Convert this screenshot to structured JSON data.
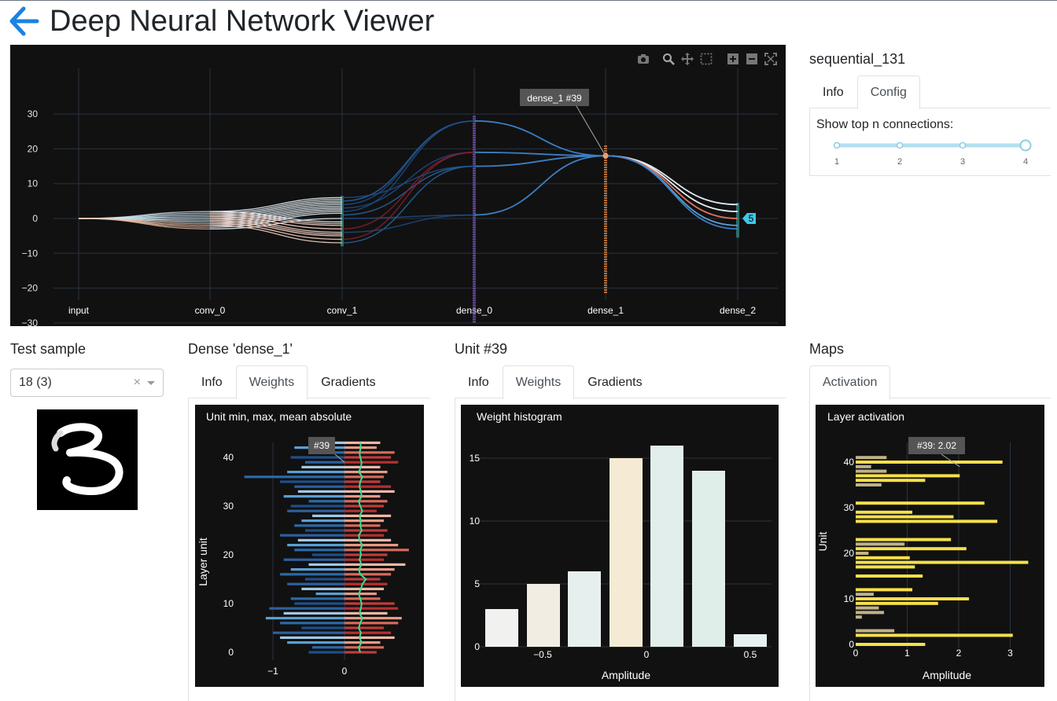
{
  "header": {
    "title": "Deep Neural Network Viewer"
  },
  "model": {
    "name": "sequential_131",
    "tabs": [
      "Info",
      "Config"
    ],
    "active_tab": "Config"
  },
  "config": {
    "label": "Show top n connections:",
    "slider_ticks": [
      "1",
      "2",
      "3",
      "4"
    ],
    "value": 4
  },
  "network_graph": {
    "y_ticks": [
      "30",
      "20",
      "10",
      "0",
      "−10",
      "−20",
      "−30"
    ],
    "layers": [
      "input",
      "conv_0",
      "conv_1",
      "dense_0",
      "dense_1",
      "dense_2"
    ],
    "hover_label": "dense_1 #39",
    "output_badge": "5",
    "modebar": [
      "camera-icon",
      "zoom-icon",
      "pan-icon",
      "select-box-icon",
      "zoom-in-icon",
      "zoom-out-icon",
      "autoscale-icon"
    ]
  },
  "test_sample": {
    "title": "Test sample",
    "selected": "18 (3)",
    "clear": "×"
  },
  "dense_panel": {
    "title": "Dense 'dense_1'",
    "tabs": [
      "Info",
      "Weights",
      "Gradients"
    ],
    "active_tab": "Weights"
  },
  "unit_panel": {
    "title": "Unit #39",
    "tabs": [
      "Info",
      "Weights",
      "Gradients"
    ],
    "active_tab": "Weights"
  },
  "maps_panel": {
    "title": "Maps",
    "tabs": [
      "Activation"
    ],
    "active_tab": "Activation"
  },
  "chart_data": [
    {
      "type": "bar",
      "title": "Unit min, max, mean absolute",
      "ylabel": "Layer unit",
      "xlabel": "",
      "x_ticks": [
        "−1",
        "0"
      ],
      "y_ticks": [
        "0",
        "10",
        "20",
        "30",
        "40"
      ],
      "hover_label": "#39",
      "series": [
        {
          "name": "min",
          "values": [
            -0.5,
            -0.45,
            -0.8,
            -0.9,
            -1.0,
            -0.6,
            -0.9,
            -1.1,
            -0.85,
            -1.05,
            -0.7,
            -0.75,
            -0.4,
            -0.6,
            -0.8,
            -0.55,
            -0.9,
            -0.75,
            -0.5,
            -0.85,
            -0.45,
            -0.7,
            -0.8,
            -0.65,
            -0.9,
            -0.55,
            -0.7,
            -0.6,
            -0.45,
            -0.8,
            -0.75,
            -0.5,
            -0.85,
            -0.65,
            -0.7,
            -0.9,
            -1.4,
            -0.8,
            -0.6,
            -0.55,
            -0.75,
            -0.45,
            -0.7,
            -0.5
          ]
        },
        {
          "name": "max",
          "values": [
            0.45,
            0.55,
            0.5,
            0.7,
            0.65,
            0.55,
            0.75,
            0.8,
            0.6,
            0.75,
            0.7,
            0.5,
            0.45,
            0.55,
            0.6,
            0.5,
            0.65,
            0.7,
            0.85,
            0.55,
            0.6,
            0.9,
            0.75,
            0.65,
            0.55,
            0.6,
            0.5,
            0.55,
            0.65,
            0.45,
            0.55,
            0.6,
            0.5,
            0.7,
            0.65,
            0.5,
            0.55,
            0.6,
            0.5,
            0.75,
            0.65,
            0.7,
            0.45,
            0.5
          ]
        },
        {
          "name": "mean absolute",
          "values": [
            0.22,
            0.2,
            0.24,
            0.21,
            0.23,
            0.2,
            0.22,
            0.25,
            0.21,
            0.23,
            0.24,
            0.22,
            0.2,
            0.23,
            0.25,
            0.3,
            0.22,
            0.2,
            0.24,
            0.21,
            0.23,
            0.22,
            0.25,
            0.21,
            0.2,
            0.24,
            0.22,
            0.23,
            0.21,
            0.25,
            0.22,
            0.2,
            0.24,
            0.23,
            0.21,
            0.22,
            0.25,
            0.2,
            0.23,
            0.24,
            0.22,
            0.21,
            0.23,
            0.22
          ]
        }
      ],
      "xlim": [
        -1.4,
        1.0
      ],
      "ylim": [
        -1,
        44
      ]
    },
    {
      "type": "bar",
      "title": "Weight histogram",
      "xlabel": "Amplitude",
      "ylabel": "",
      "x_ticks": [
        "−0.5",
        "0",
        "0.5"
      ],
      "y_ticks": [
        "0",
        "5",
        "10",
        "15"
      ],
      "x": [
        -0.8,
        -0.6,
        -0.4,
        -0.2,
        0.0,
        0.2,
        0.5
      ],
      "values": [
        3,
        5,
        6,
        15,
        16,
        14,
        1
      ],
      "colors": [
        "#f1f1ef",
        "#f2ede3",
        "#e6efee",
        "#f5ead4",
        "#e1eeec",
        "#e0eeea",
        "#e6f0f0"
      ],
      "ylim": [
        0,
        17
      ]
    },
    {
      "type": "bar",
      "title": "Layer activation",
      "xlabel": "Amplitude",
      "ylabel": "Unit",
      "x_ticks": [
        "0",
        "1",
        "2",
        "3"
      ],
      "y_ticks": [
        "0",
        "10",
        "20",
        "30",
        "40"
      ],
      "hover_label": "#39: 2.02",
      "units": [
        0,
        2,
        3,
        6,
        7,
        8,
        9,
        10,
        11,
        12,
        15,
        17,
        18,
        19,
        20,
        21,
        22,
        23,
        27,
        28,
        29,
        31,
        35,
        36,
        37,
        38,
        39,
        40,
        41
      ],
      "values": [
        1.35,
        3.05,
        0.75,
        0.12,
        0.55,
        0.45,
        1.6,
        2.2,
        0.35,
        1.1,
        1.3,
        1.15,
        3.35,
        1.05,
        0.25,
        2.15,
        0.95,
        1.85,
        2.75,
        1.9,
        1.1,
        2.5,
        0.5,
        1.35,
        2.02,
        0.6,
        0.3,
        2.85,
        0.6
      ],
      "xlim": [
        0,
        3.6
      ],
      "ylim": [
        -1,
        45
      ]
    }
  ]
}
